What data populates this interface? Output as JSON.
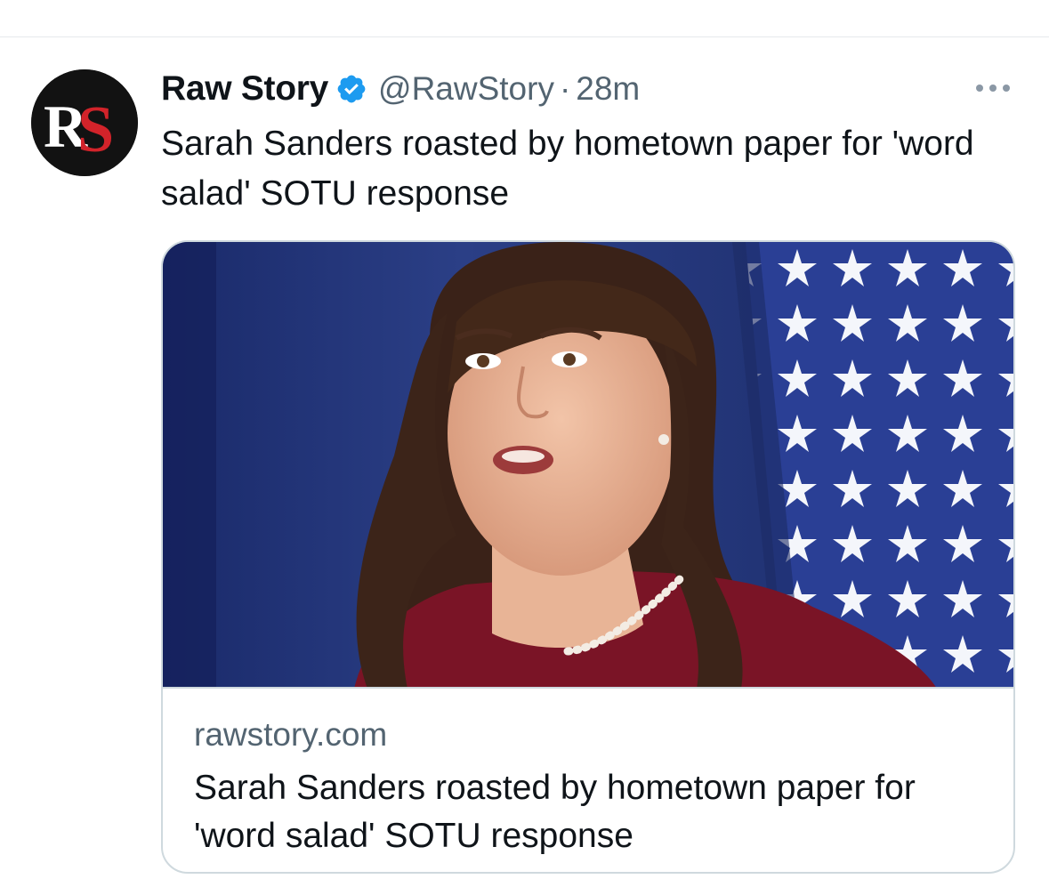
{
  "tweet": {
    "author": {
      "name": "Raw Story",
      "handle": "@RawStory",
      "verified": true,
      "avatar_icon": "raw-story-rs-logo"
    },
    "separator": "·",
    "timestamp": "28m",
    "text": "Sarah Sanders roasted by hometown paper for 'word salad' SOTU response",
    "more_icon": "more-horizontal-icon"
  },
  "card": {
    "image_description_icon": "article-photo",
    "domain": "rawstory.com",
    "title": "Sarah Sanders roasted by hometown paper for 'word salad' SOTU response"
  },
  "colors": {
    "text_primary": "#0f1419",
    "text_secondary": "#536471",
    "verified_blue": "#1d9bf0",
    "card_border": "#cfd9de",
    "logo_red": "#d2232a"
  }
}
